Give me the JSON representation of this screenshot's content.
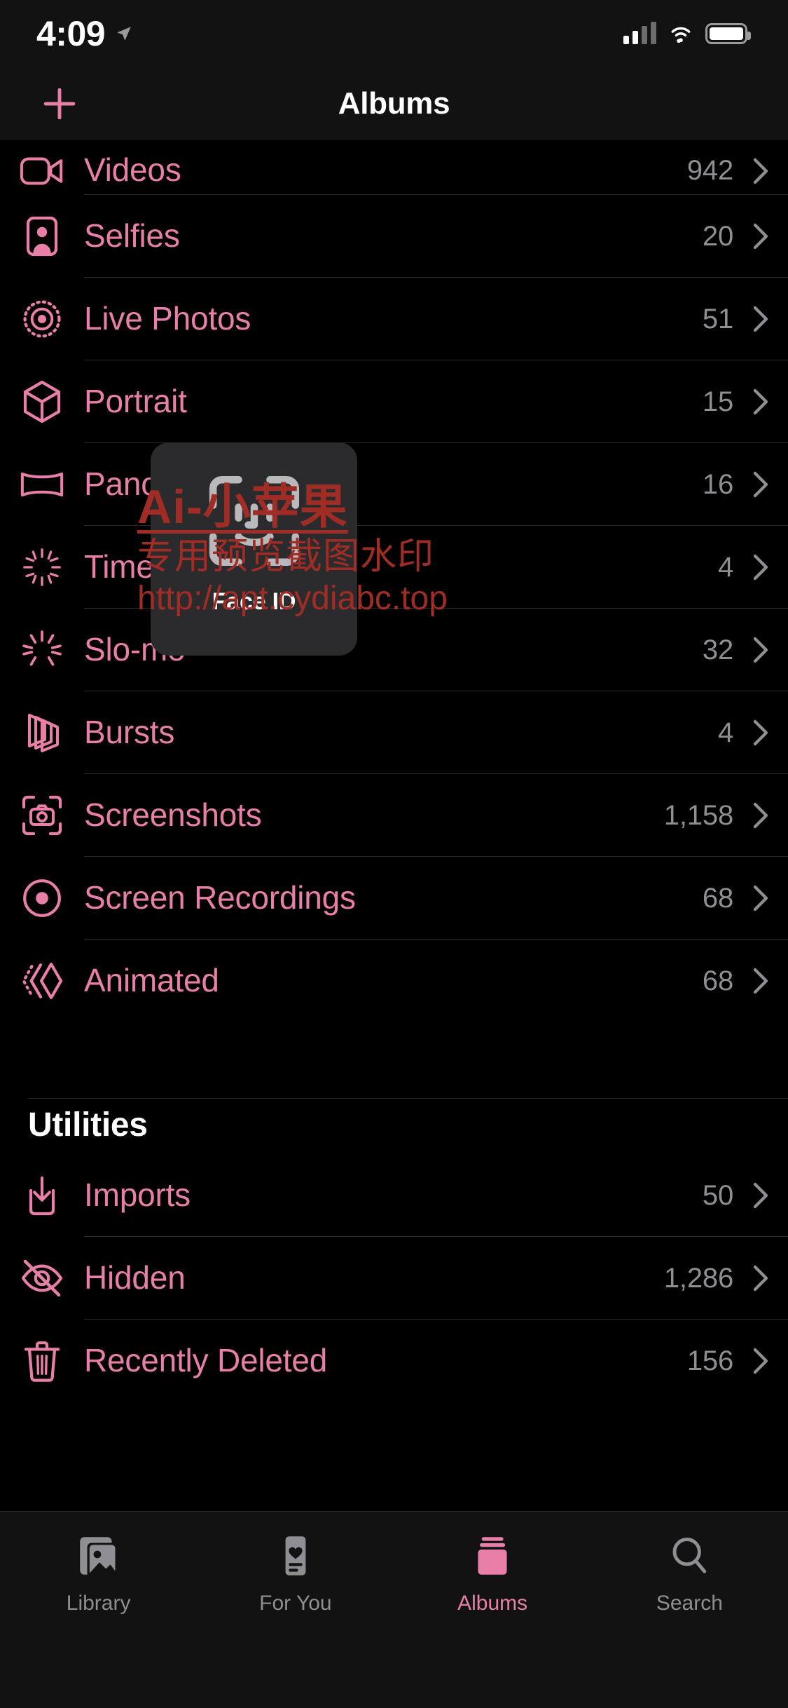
{
  "statusbar": {
    "time": "4:09",
    "location_icon": "location-arrow-icon",
    "cellular_icon": "cellular-bars-icon",
    "wifi_icon": "wifi-icon",
    "battery_icon": "battery-icon"
  },
  "navbar": {
    "title": "Albums",
    "add_icon": "plus-icon",
    "add_label": "+"
  },
  "media_types": {
    "rows": [
      {
        "label": "Videos",
        "count": "942",
        "icon": "video-camera-icon"
      },
      {
        "label": "Selfies",
        "count": "20",
        "icon": "selfies-person-icon"
      },
      {
        "label": "Live Photos",
        "count": "51",
        "icon": "live-photos-icon"
      },
      {
        "label": "Portrait",
        "count": "15",
        "icon": "cube-icon"
      },
      {
        "label": "Panoramas",
        "count": "16",
        "icon": "panorama-icon"
      },
      {
        "label": "Time-lapse",
        "count": "4",
        "icon": "timelapse-icon"
      },
      {
        "label": "Slo-mo",
        "count": "32",
        "icon": "slomo-icon"
      },
      {
        "label": "Bursts",
        "count": "4",
        "icon": "bursts-icon"
      },
      {
        "label": "Screenshots",
        "count": "1,158",
        "icon": "screenshot-camera-icon"
      },
      {
        "label": "Screen Recordings",
        "count": "68",
        "icon": "screen-recording-icon"
      },
      {
        "label": "Animated",
        "count": "68",
        "icon": "animated-icon"
      }
    ]
  },
  "utilities": {
    "header": "Utilities",
    "rows": [
      {
        "label": "Imports",
        "count": "50",
        "icon": "import-tray-icon"
      },
      {
        "label": "Hidden",
        "count": "1,286",
        "icon": "eye-slash-icon"
      },
      {
        "label": "Recently Deleted",
        "count": "156",
        "icon": "trash-icon"
      }
    ]
  },
  "faceid": {
    "label": "Face ID",
    "icon": "faceid-bracket-icon"
  },
  "watermark": {
    "line1": "Ai-小苹果",
    "line2": "专用预览截图水印",
    "line3": "http://apt.cydiabc.top"
  },
  "tabbar": {
    "tabs": [
      {
        "label": "Library",
        "icon": "photos-library-icon",
        "active": false
      },
      {
        "label": "For You",
        "icon": "for-you-card-icon",
        "active": false
      },
      {
        "label": "Albums",
        "icon": "albums-stack-icon",
        "active": true
      },
      {
        "label": "Search",
        "icon": "magnifier-icon",
        "active": false
      }
    ]
  },
  "colors": {
    "accent_pink": "#e87fa8",
    "background": "#000000",
    "chrome": "#121212",
    "separator": "#2a2a2a",
    "secondary_text": "#8e8e93",
    "hud_background": "#2b2b2d",
    "watermark_red": "#a02c26"
  }
}
